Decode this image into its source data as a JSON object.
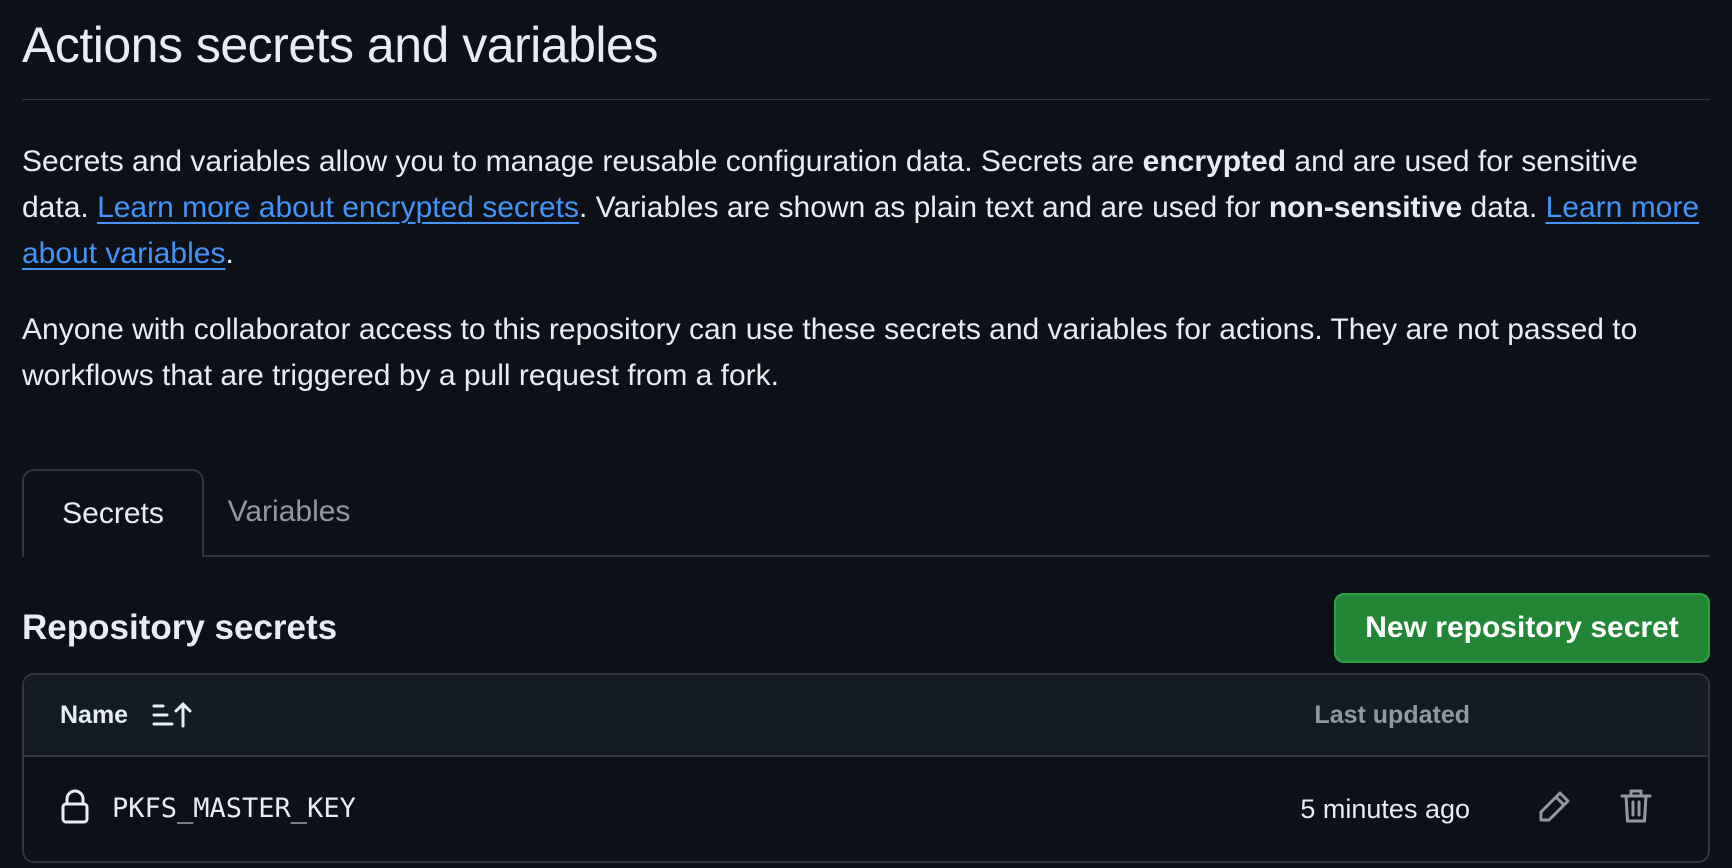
{
  "page": {
    "title": "Actions secrets and variables"
  },
  "intro": {
    "text_1": "Secrets and variables allow you to manage reusable configuration data. Secrets are ",
    "bold_1": "encrypted",
    "text_2": " and are used for sensitive data. ",
    "link_secrets": "Learn more about encrypted secrets",
    "text_3": ". Variables are shown as plain text and are used for ",
    "bold_2": "non-sensitive",
    "text_4": " data. ",
    "link_variables": "Learn more about variables",
    "text_5": "."
  },
  "notice": "Anyone with collaborator access to this repository can use these secrets and variables for actions. They are not passed to workflows that are triggered by a pull request from a fork.",
  "tabs": [
    {
      "label": "Secrets",
      "active": true
    },
    {
      "label": "Variables",
      "active": false
    }
  ],
  "secrets_section": {
    "title": "Repository secrets",
    "new_button_label": "New repository secret",
    "columns": {
      "name": "Name",
      "last_updated": "Last updated"
    },
    "rows": [
      {
        "name": "PKFS_MASTER_KEY",
        "updated": "5 minutes ago"
      }
    ]
  },
  "icons": {
    "sort": "sort-ascending-icon",
    "lock": "lock-icon",
    "edit": "pencil-icon",
    "delete": "trash-icon"
  },
  "colors": {
    "background": "#0d1117",
    "link": "#4493f8",
    "primary_button": "#238636",
    "border": "#30363d",
    "muted_text": "#9198a1"
  }
}
